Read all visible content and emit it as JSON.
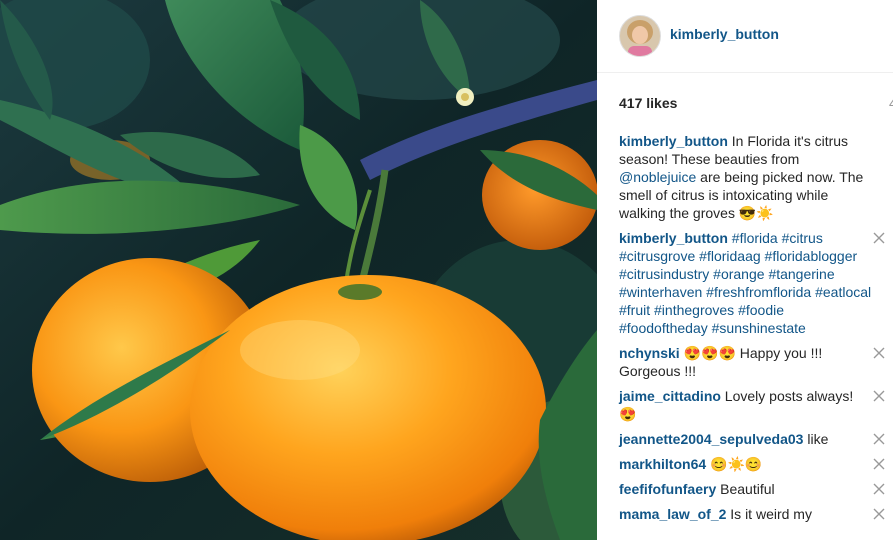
{
  "post": {
    "username": "kimberly_button",
    "likes": "417 likes",
    "likes_edge": "4"
  },
  "caption": {
    "author": "kimberly_button",
    "text_1": " In Florida it's citrus season! These beauties from ",
    "mention": "@noblejuice",
    "text_2": " are being picked now. The smell of citrus is intoxicating while walking the groves 😎☀️"
  },
  "hashtag_comment": {
    "author": "kimberly_button",
    "tags": [
      "#florida",
      "#citrus",
      "#citrusgrove",
      "#floridaag",
      "#floridablogger",
      "#citrusindustry",
      "#orange",
      "#tangerine",
      "#winterhaven",
      "#freshfromflorida",
      "#eatlocal",
      "#fruit",
      "#inthegroves",
      "#foodie",
      "#foodoftheday",
      "#sunshinestate"
    ]
  },
  "comments": [
    {
      "author": "nchynski",
      "text": " 😍😍😍 Happy you !!! Gorgeous !!!"
    },
    {
      "author": "jaime_cittadino",
      "text": " Lovely posts always! 😍"
    },
    {
      "author": "jeannette2004_sepulveda03",
      "text": " like"
    },
    {
      "author": "markhilton64",
      "text": " 😊☀️😊"
    },
    {
      "author": "feefifofunfaery",
      "text": " Beautiful"
    },
    {
      "author": "mama_law_of_2",
      "text": " Is it weird my"
    }
  ],
  "icons": {
    "close": "close-icon",
    "avatar": "avatar",
    "photo": "oranges-photo"
  },
  "colors": {
    "link": "#125688",
    "text": "#262626",
    "orange": "#f7a21b"
  }
}
